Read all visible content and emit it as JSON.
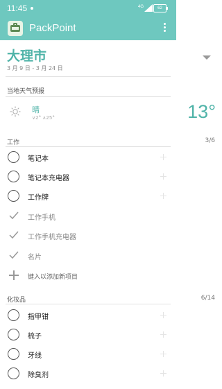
{
  "status": {
    "time": "11:45",
    "network": "4G",
    "battery": "62"
  },
  "app": {
    "title": "PackPoint"
  },
  "trip": {
    "destination": "大理市",
    "dates": "3 月 9 日 - 3 月 24 日"
  },
  "weather": {
    "heading": "当地天气预报",
    "condition": "晴",
    "range": "∨2° ∧25°",
    "temperature": "13°"
  },
  "sections": [
    {
      "title": "工作",
      "count": "3/6",
      "items": [
        {
          "label": "笔记本",
          "checked": false
        },
        {
          "label": "笔记本充电器",
          "checked": false
        },
        {
          "label": "工作牌",
          "checked": false
        },
        {
          "label": "工作手机",
          "checked": true
        },
        {
          "label": "工作手机充电器",
          "checked": true
        },
        {
          "label": "名片",
          "checked": true
        }
      ],
      "add_placeholder": "键入以添加新项目"
    },
    {
      "title": "化妆品",
      "count": "6/14",
      "items": [
        {
          "label": "指甲钳",
          "checked": false
        },
        {
          "label": "梳子",
          "checked": false
        },
        {
          "label": "牙线",
          "checked": false
        },
        {
          "label": "除臭剂",
          "checked": false
        }
      ]
    }
  ],
  "colors": {
    "accent": "#6ec8bf",
    "accent_text": "#4fb3a8"
  }
}
